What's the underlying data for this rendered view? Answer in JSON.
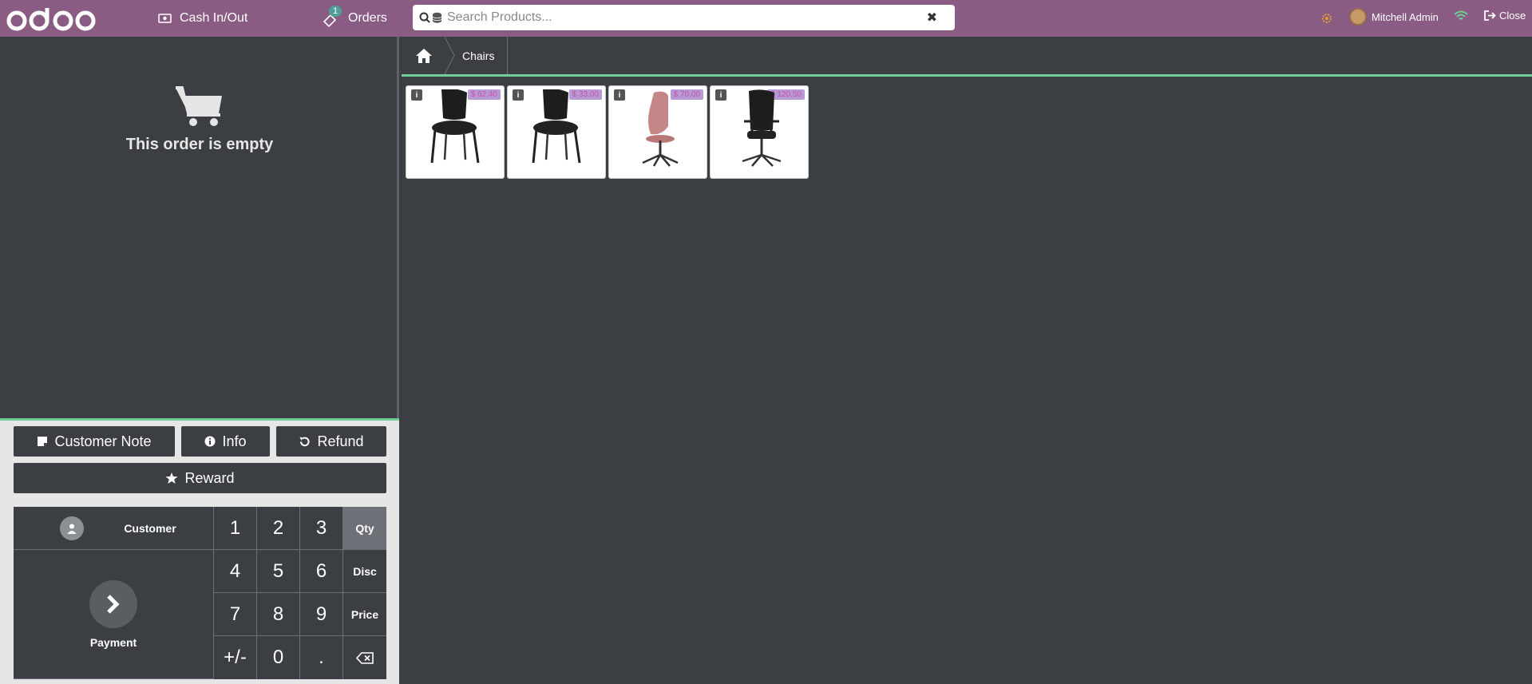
{
  "header": {
    "cash_label": "Cash In/Out",
    "orders_label": "Orders",
    "orders_count": "1",
    "search_placeholder": "Search Products...",
    "user_name": "Mitchell Admin",
    "close_label": "Close"
  },
  "order": {
    "empty_message": "This order is empty"
  },
  "actions": {
    "customer_note": "Customer Note",
    "info": "Info",
    "refund": "Refund",
    "reward": "Reward"
  },
  "numpad": {
    "customer_label": "Customer",
    "payment_label": "Payment",
    "keys": [
      "1",
      "2",
      "3",
      "4",
      "5",
      "6",
      "7",
      "8",
      "9",
      "+/-",
      "0",
      "."
    ],
    "modes": [
      "Qty",
      "Disc",
      "Price"
    ],
    "active_mode": "Qty"
  },
  "breadcrumb": {
    "category": "Chairs"
  },
  "products": [
    {
      "price": "$ 62.40",
      "image": "black-stacking-chair"
    },
    {
      "price": "$ 33.00",
      "image": "black-stacking-chair"
    },
    {
      "price": "$ 70.00",
      "image": "pink-office-chair"
    },
    {
      "price": "$ 120.50",
      "image": "black-executive-chair"
    }
  ],
  "colors": {
    "topbar": "#8a5c84",
    "background": "#3b3e43",
    "accent": "#6fcf97",
    "control_bg": "#e6e6e6"
  }
}
